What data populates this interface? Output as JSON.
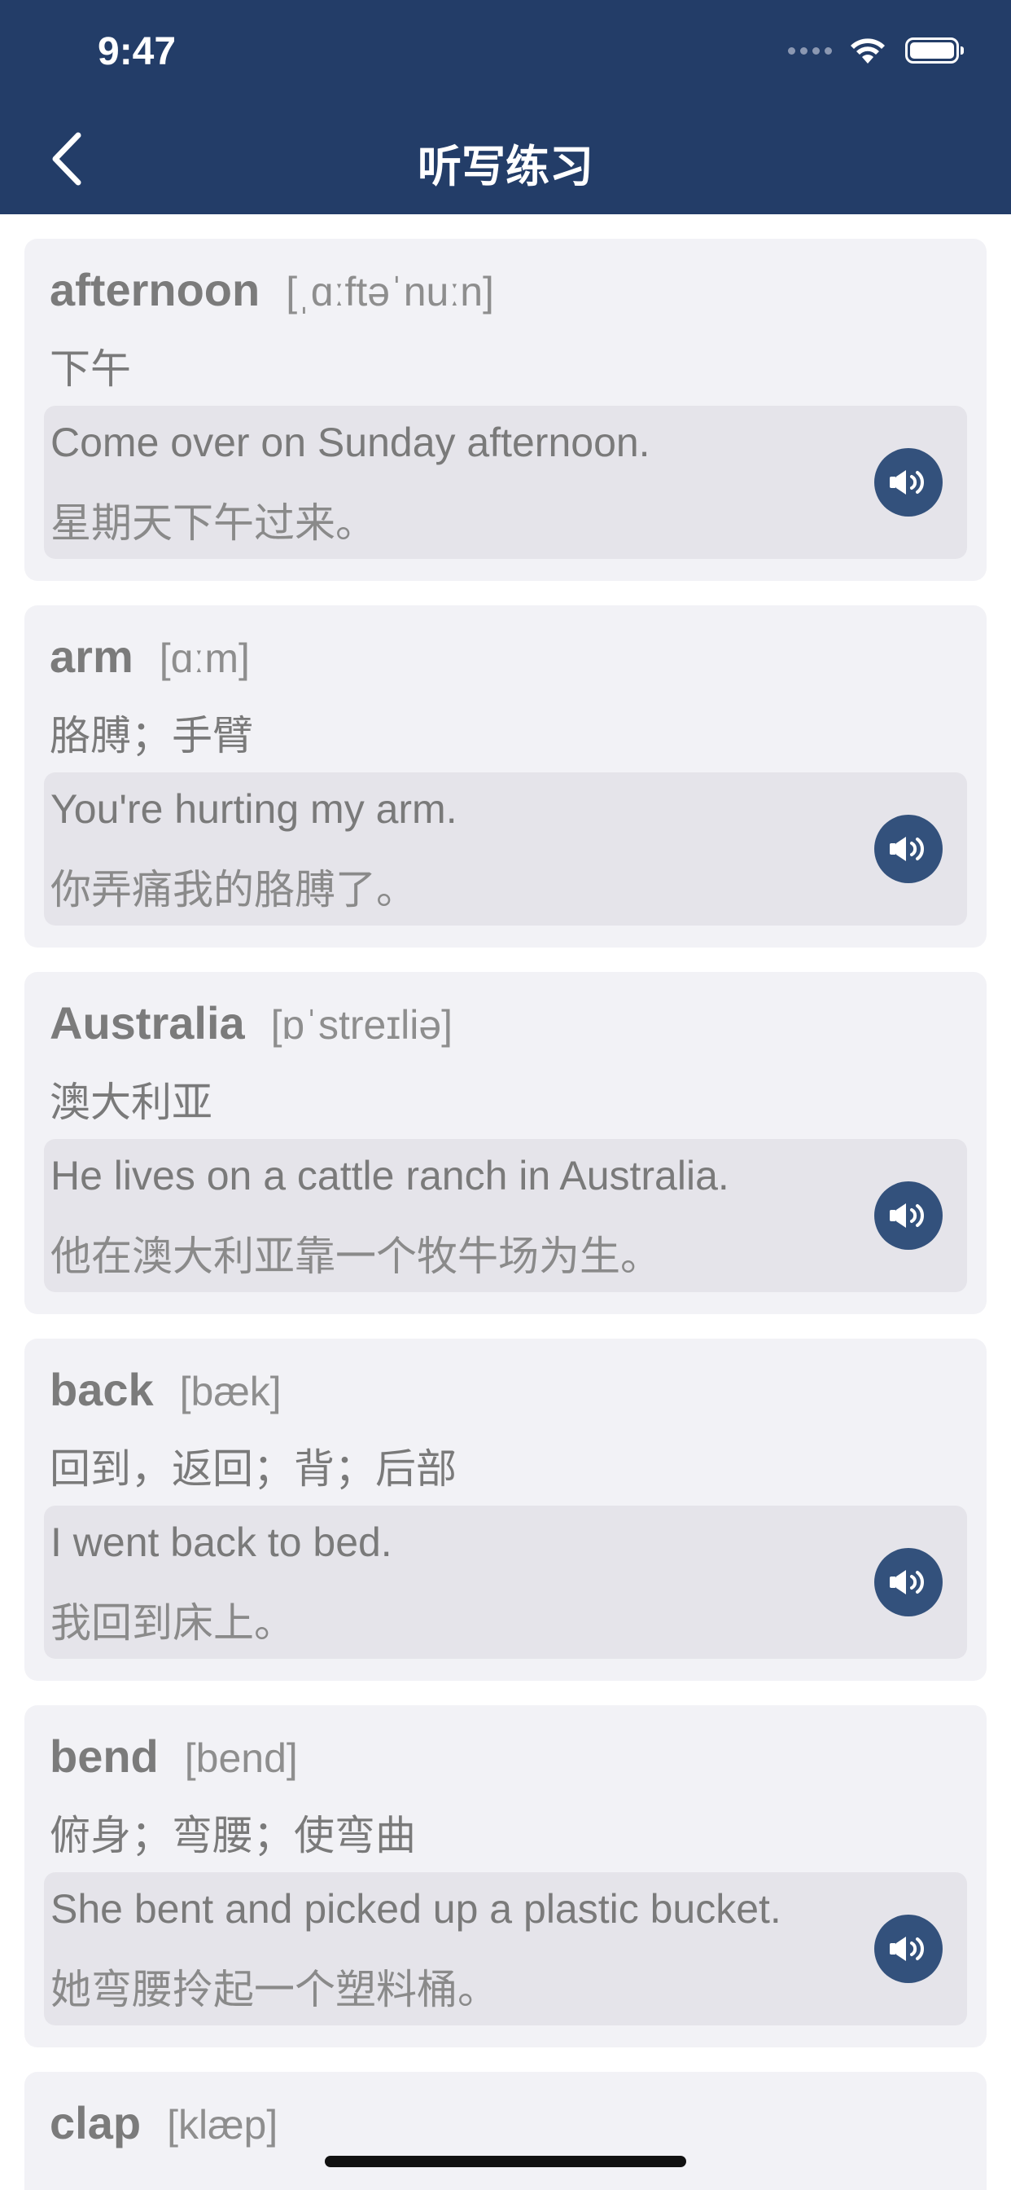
{
  "status_bar": {
    "time": "9:47"
  },
  "nav": {
    "title": "听写练习"
  },
  "colors": {
    "nav_bg": "#233d68",
    "card_bg": "#f2f2f6",
    "example_bg": "#e5e4ea",
    "speaker_bg": "#33517c"
  },
  "icons": {
    "back": "chevron-left-icon",
    "speaker": "speaker-icon",
    "wifi": "wifi-icon",
    "battery": "battery-icon"
  },
  "words": [
    {
      "word": "afternoon",
      "phonetic": "[ˌɑːftəˈnuːn]",
      "meaning": "下午",
      "example_en": "Come over on Sunday afternoon.",
      "example_zh": "星期天下午过来。"
    },
    {
      "word": "arm",
      "phonetic": "[ɑːm]",
      "meaning": "胳膊；手臂",
      "example_en": "You're hurting my arm.",
      "example_zh": "你弄痛我的胳膊了。"
    },
    {
      "word": "Australia",
      "phonetic": "[ɒˈstreɪliə]",
      "meaning": "澳大利亚",
      "example_en": "He lives on a cattle ranch in Australia.",
      "example_zh": "他在澳大利亚靠一个牧牛场为生。"
    },
    {
      "word": "back",
      "phonetic": "[bæk]",
      "meaning": "回到，返回；背；后部",
      "example_en": "I went back to bed.",
      "example_zh": "我回到床上。"
    },
    {
      "word": "bend",
      "phonetic": "[bend]",
      "meaning": "俯身；弯腰；使弯曲",
      "example_en": "She bent and picked up a plastic bucket.",
      "example_zh": "她弯腰拎起一个塑料桶。"
    },
    {
      "word": "clap",
      "phonetic": "[klæp]"
    }
  ]
}
